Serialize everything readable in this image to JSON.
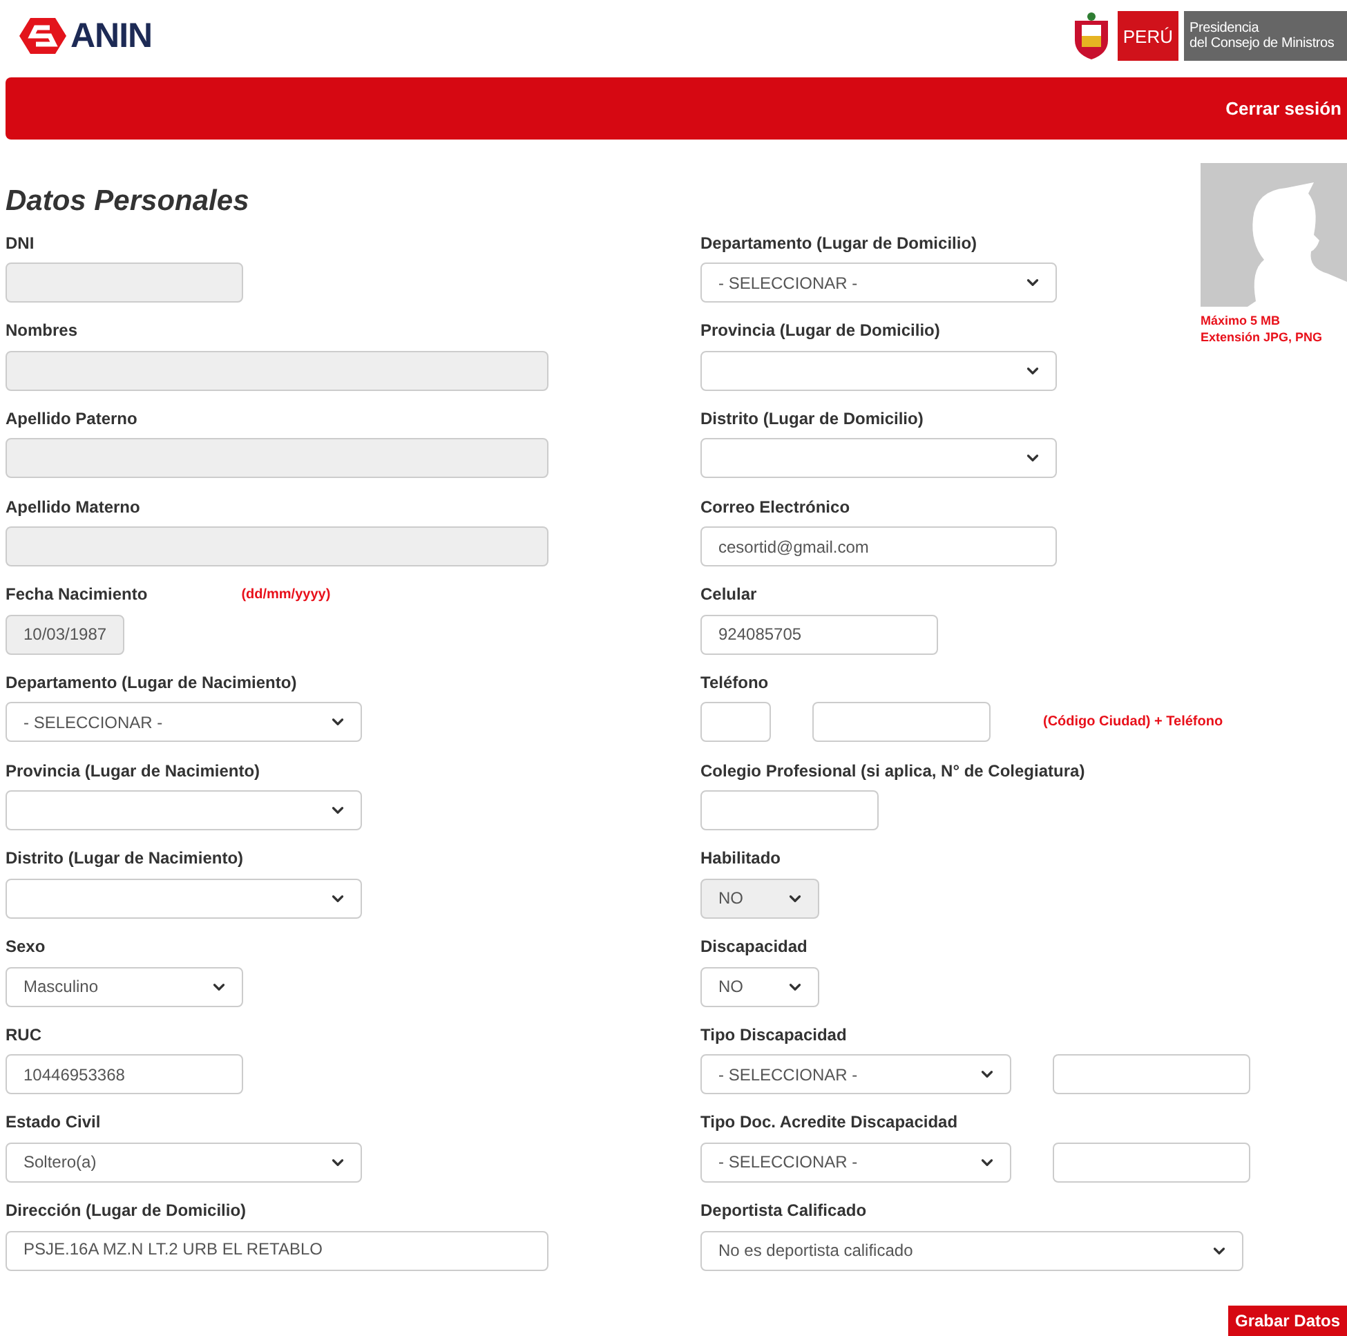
{
  "header": {
    "logo": "ANIN",
    "gov_badge": "PERÚ",
    "gov_name_lines": [
      "Presidencia",
      "del Consejo de Ministros"
    ]
  },
  "nav": {
    "logout": "Cerrar sesión"
  },
  "title": "Datos Personales",
  "photo": {
    "notes": [
      "Máximo 5 MB",
      "Extensión JPG, PNG"
    ]
  },
  "left_fields": [
    {
      "label": "DNI",
      "controls": [
        {
          "kind": "input",
          "disabled": true
        }
      ]
    },
    {
      "label": "Nombres",
      "controls": [
        {
          "kind": "input",
          "disabled": true
        }
      ]
    },
    {
      "label": "Apellido Paterno",
      "controls": [
        {
          "kind": "input",
          "disabled": true
        }
      ]
    },
    {
      "label": "Apellido Materno",
      "controls": [
        {
          "kind": "input",
          "disabled": true
        }
      ]
    },
    {
      "label": "Fecha Nacimiento",
      "label_note": "(dd/mm/yyyy)",
      "controls": [
        {
          "kind": "input",
          "value": "10/03/1987",
          "disabled": true
        }
      ]
    },
    {
      "label": "Departamento (Lugar de Nacimiento)",
      "controls": [
        {
          "kind": "select",
          "value": "- SELECCIONAR -",
          "disabled": false
        }
      ]
    },
    {
      "label": "Provincia (Lugar de Nacimiento)",
      "controls": [
        {
          "kind": "select",
          "disabled": false
        }
      ]
    },
    {
      "label": "Distrito (Lugar de Nacimiento)",
      "controls": [
        {
          "kind": "select",
          "disabled": false
        }
      ]
    },
    {
      "label": "Sexo",
      "controls": [
        {
          "kind": "select",
          "value": "Masculino",
          "disabled": false
        }
      ]
    },
    {
      "label": "RUC",
      "controls": [
        {
          "kind": "input",
          "value": "10446953368",
          "disabled": false
        }
      ]
    },
    {
      "label": "Estado Civil",
      "controls": [
        {
          "kind": "select",
          "value": "Soltero(a)",
          "disabled": false
        }
      ]
    },
    {
      "label": "Dirección (Lugar de Domicilio)",
      "controls": [
        {
          "kind": "textarea",
          "value": "PSJE.16A MZ.N LT.2 URB EL RETABLO",
          "disabled": false
        }
      ]
    }
  ],
  "right_fields": [
    {
      "label": "Departamento (Lugar de Domicilio)",
      "controls": [
        {
          "kind": "select",
          "value": "- SELECCIONAR -",
          "disabled": false
        }
      ]
    },
    {
      "label": "Provincia (Lugar de Domicilio)",
      "controls": [
        {
          "kind": "select",
          "disabled": false
        }
      ]
    },
    {
      "label": "Distrito (Lugar de Domicilio)",
      "controls": [
        {
          "kind": "select",
          "disabled": false
        }
      ]
    },
    {
      "label": "Correo Electrónico",
      "controls": [
        {
          "kind": "input",
          "value": "cesortid@gmail.com",
          "disabled": false
        }
      ]
    },
    {
      "label": "Celular",
      "controls": [
        {
          "kind": "input",
          "value": "924085705",
          "disabled": false
        }
      ]
    },
    {
      "label": "Teléfono",
      "note": "(Código Ciudad) + Teléfono",
      "controls": [
        {
          "kind": "input",
          "disabled": false
        },
        {
          "kind": "input",
          "disabled": false
        }
      ]
    },
    {
      "label": "Colegio Profesional (si aplica, N° de Colegiatura)",
      "controls": [
        {
          "kind": "input",
          "disabled": false
        }
      ]
    },
    {
      "label": "Habilitado",
      "controls": [
        {
          "kind": "select",
          "value": "NO",
          "disabled": true
        }
      ]
    },
    {
      "label": "Discapacidad",
      "controls": [
        {
          "kind": "select",
          "value": "NO",
          "disabled": false
        }
      ]
    },
    {
      "label": "Tipo Discapacidad",
      "controls": [
        {
          "kind": "select",
          "value": "- SELECCIONAR -",
          "disabled": false
        },
        {
          "kind": "input",
          "disabled": false
        }
      ]
    },
    {
      "label": "Tipo Doc. Acredite Discapacidad",
      "controls": [
        {
          "kind": "select",
          "value": "- SELECCIONAR -",
          "disabled": false
        },
        {
          "kind": "input",
          "disabled": false
        }
      ]
    },
    {
      "label": "Deportista Calificado",
      "controls": [
        {
          "kind": "select",
          "value": "No es deportista calificado",
          "disabled": false
        }
      ]
    }
  ],
  "save_button": "Grabar Datos"
}
